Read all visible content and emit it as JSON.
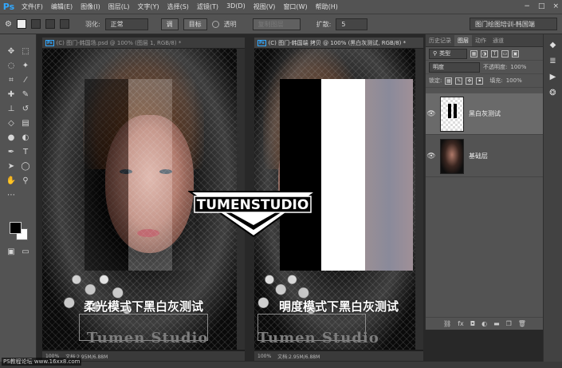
{
  "app": {
    "logo": "Ps"
  },
  "menu": [
    "文件(F)",
    "编辑(E)",
    "图像(I)",
    "图层(L)",
    "文字(Y)",
    "选择(S)",
    "滤镜(T)",
    "3D(D)",
    "视图(V)",
    "窗口(W)",
    "帮助(H)"
  ],
  "window_controls": [
    "−",
    "□",
    "×"
  ],
  "options": {
    "feather_label": "羽化:",
    "feather_value": "正常",
    "btn_adjust": "调",
    "btn_target": "目标",
    "transparent_label": "透明",
    "clear_label": "复制图层",
    "expand_label": "扩散:",
    "expand_value": "5",
    "workspace": "图门绘图培训-韩国端"
  },
  "documents": [
    {
      "tab": "(C) 图门-韩国场.psd @ 100% (图层 1, RGB/8) *",
      "status": [
        "100%",
        "文档:2.95M/6.88M"
      ],
      "caption": "柔光模式下黑白灰测试",
      "brand": "Tumen Studio"
    },
    {
      "tab": "(C) 图门-韩国端 拷贝 @ 100% (黑白灰测试, RGB/8) *",
      "status": [
        "100%",
        "文档:2.95M/6.88M"
      ],
      "caption": "明度模式下黑白灰测试",
      "brand": "Tumen Studio"
    }
  ],
  "logo_text": "TUMENSTUDIO",
  "panel": {
    "tabs": [
      "历史记录",
      "图层",
      "动作",
      "通道"
    ],
    "active_tab": "图层",
    "kind_label": "类型",
    "blend_mode": "明度",
    "opacity_label": "不透明度:",
    "opacity": "100%",
    "lock_label": "锁定:",
    "fill_label": "填充:",
    "fill": "100%",
    "layers": [
      {
        "name": "黑白灰测试",
        "selected": true
      },
      {
        "name": "基础层",
        "selected": false
      }
    ],
    "bottom_icons": [
      "link-icon",
      "fx-icon",
      "mask-icon",
      "adjustment-icon",
      "folder-icon",
      "new-layer-icon",
      "trash-icon"
    ]
  },
  "watermark": "PS教程论坛 www.16xx8.com"
}
